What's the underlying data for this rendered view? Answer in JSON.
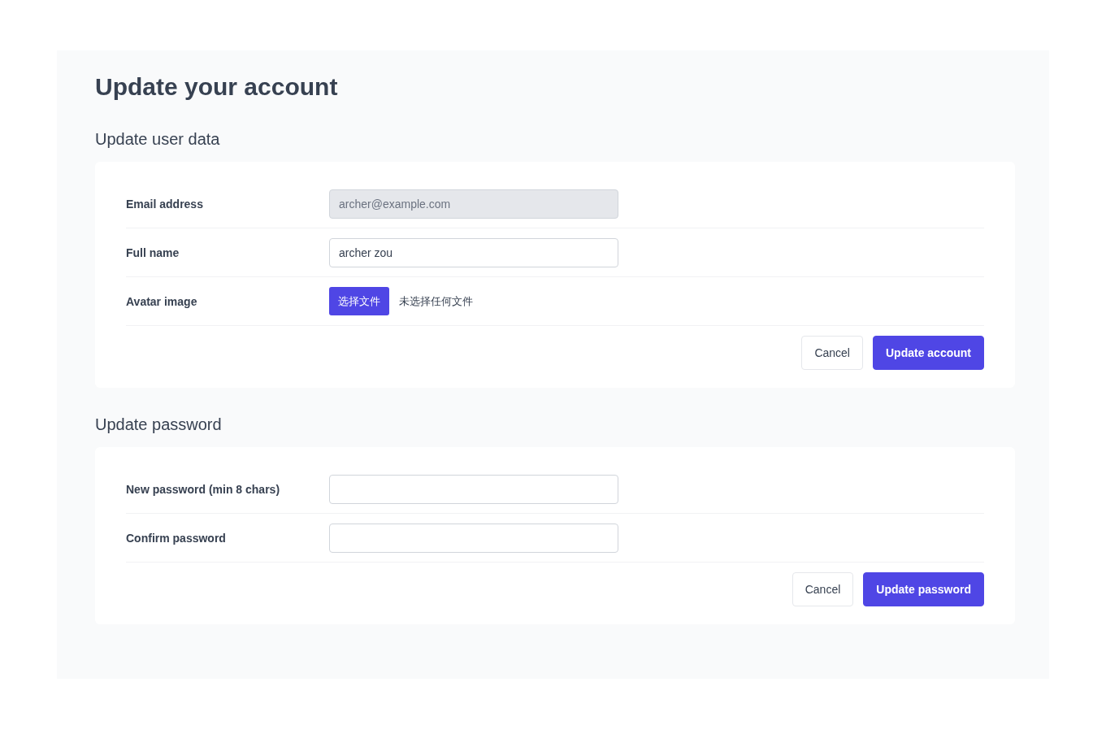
{
  "title": "Update your account",
  "sections": [
    {
      "heading": "Update user data",
      "fields": [
        {
          "kind": "text",
          "label": "Email address",
          "value": "archer@example.com",
          "disabled": true
        },
        {
          "kind": "text",
          "label": "Full name",
          "value": "archer zou",
          "disabled": false
        },
        {
          "kind": "file",
          "label": "Avatar image",
          "button": "选择文件",
          "status": "未选择任何文件"
        }
      ],
      "buttons": [
        {
          "label": "Cancel",
          "primary": false
        },
        {
          "label": "Update account",
          "primary": true
        }
      ]
    },
    {
      "heading": "Update password",
      "fields": [
        {
          "kind": "password",
          "label": "New password (min 8 chars)",
          "disabled": false
        },
        {
          "kind": "password",
          "label": "Confirm password",
          "disabled": false
        }
      ],
      "buttons": [
        {
          "label": "Cancel",
          "primary": false
        },
        {
          "label": "Update password",
          "primary": true
        }
      ]
    }
  ]
}
